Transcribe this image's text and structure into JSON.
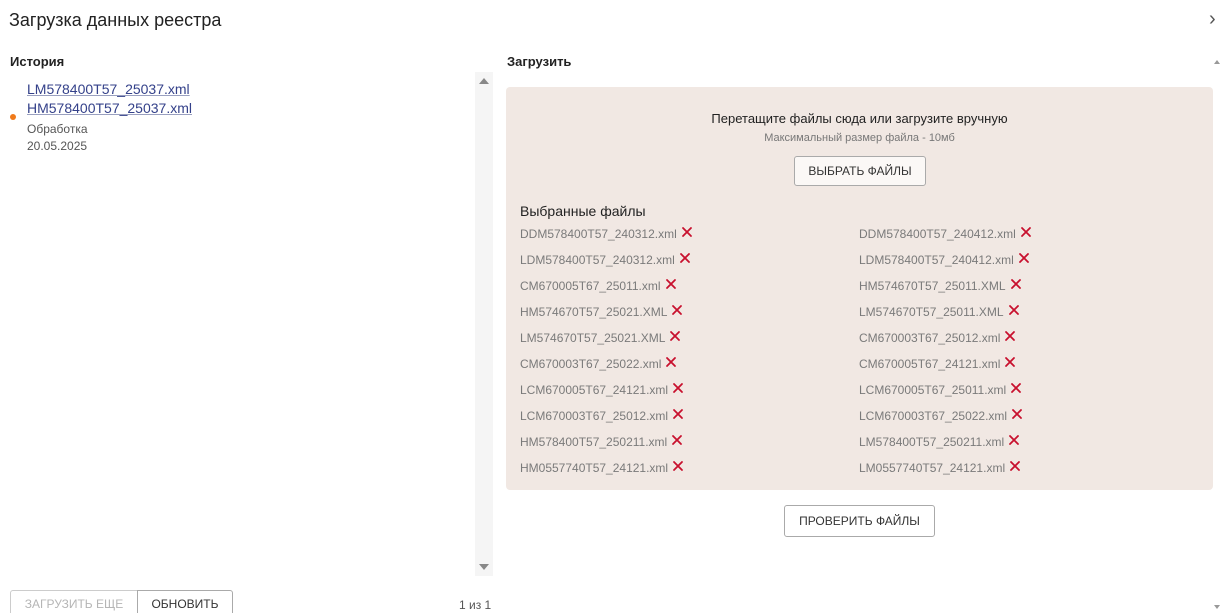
{
  "dialog": {
    "title": "Загрузка данных реестра",
    "close_icon": "close-icon",
    "close_glyph": "›"
  },
  "history": {
    "heading": "История",
    "items": [
      {
        "files": [
          "LM578400T57_25037.xml",
          "HM578400T57_25037.xml"
        ],
        "status": "Обработка",
        "status_color": "#f07a1a",
        "date": "20.05.2025"
      }
    ],
    "load_more_label": "ЗАГРУЗИТЬ ЕЩЕ",
    "refresh_label": "ОБНОВИТЬ",
    "pager": "1 из 1"
  },
  "upload": {
    "heading": "Загрузить",
    "drop_text": "Перетащите файлы сюда или загрузите вручную",
    "max_size_text": "Максимальный размер файла - 10мб",
    "choose_label": "ВЫБРАТЬ ФАЙЛЫ",
    "selected_heading": "Выбранные файлы",
    "remove_icon": "remove-icon",
    "remove_color": "#c8102e",
    "files": [
      "DDM578400T57_240312.xml",
      "DDM578400T57_240412.xml",
      "LDM578400T57_240312.xml",
      "LDM578400T57_240412.xml",
      "CM670005T67_25011.xml",
      "HM574670T57_25011.XML",
      "HM574670T57_25021.XML",
      "LM574670T57_25011.XML",
      "LM574670T57_25021.XML",
      "CM670003T67_25012.xml",
      "CM670003T67_25022.xml",
      "CM670005T67_24121.xml",
      "LCM670005T67_24121.xml",
      "LCM670005T67_25011.xml",
      "LCM670003T67_25012.xml",
      "LCM670003T67_25022.xml",
      "HM578400T57_250211.xml",
      "LM578400T57_250211.xml",
      "HM0557740T57_24121.xml",
      "LM0557740T57_24121.xml"
    ],
    "check_label": "ПРОВЕРИТЬ ФАЙЛЫ"
  }
}
